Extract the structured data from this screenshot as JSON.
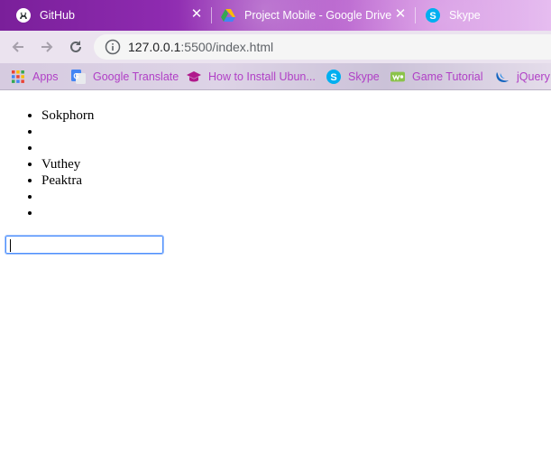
{
  "browser": {
    "tabs": [
      {
        "title": "GitHub",
        "icon": "github-icon"
      },
      {
        "title": "Project Mobile - Google Drive",
        "icon": "google-drive-icon"
      },
      {
        "title": "Skype",
        "icon": "skype-icon"
      }
    ],
    "address": {
      "host": "127.0.0.1",
      "rest": ":5500/index.html"
    },
    "bookmarks": [
      {
        "label": "Apps",
        "icon": "apps-grid-icon"
      },
      {
        "label": "Google Translate",
        "icon": "google-translate-icon"
      },
      {
        "label": "How to Install Ubun...",
        "icon": "graduation-cap-icon"
      },
      {
        "label": "Skype",
        "icon": "skype-icon"
      },
      {
        "label": "Game Tutorial",
        "icon": "game-tutorial-icon"
      },
      {
        "label": "jQuery",
        "icon": "jquery-icon"
      }
    ]
  },
  "page": {
    "list_items": [
      "Sokphorn",
      "",
      "",
      "Vuthey",
      "Peaktra",
      "",
      ""
    ],
    "input_value": ""
  },
  "colors": {
    "tab_strip": "#8e2bb0",
    "bookmark_text": "#b03fc6",
    "input_focus": "#4d90fe"
  }
}
